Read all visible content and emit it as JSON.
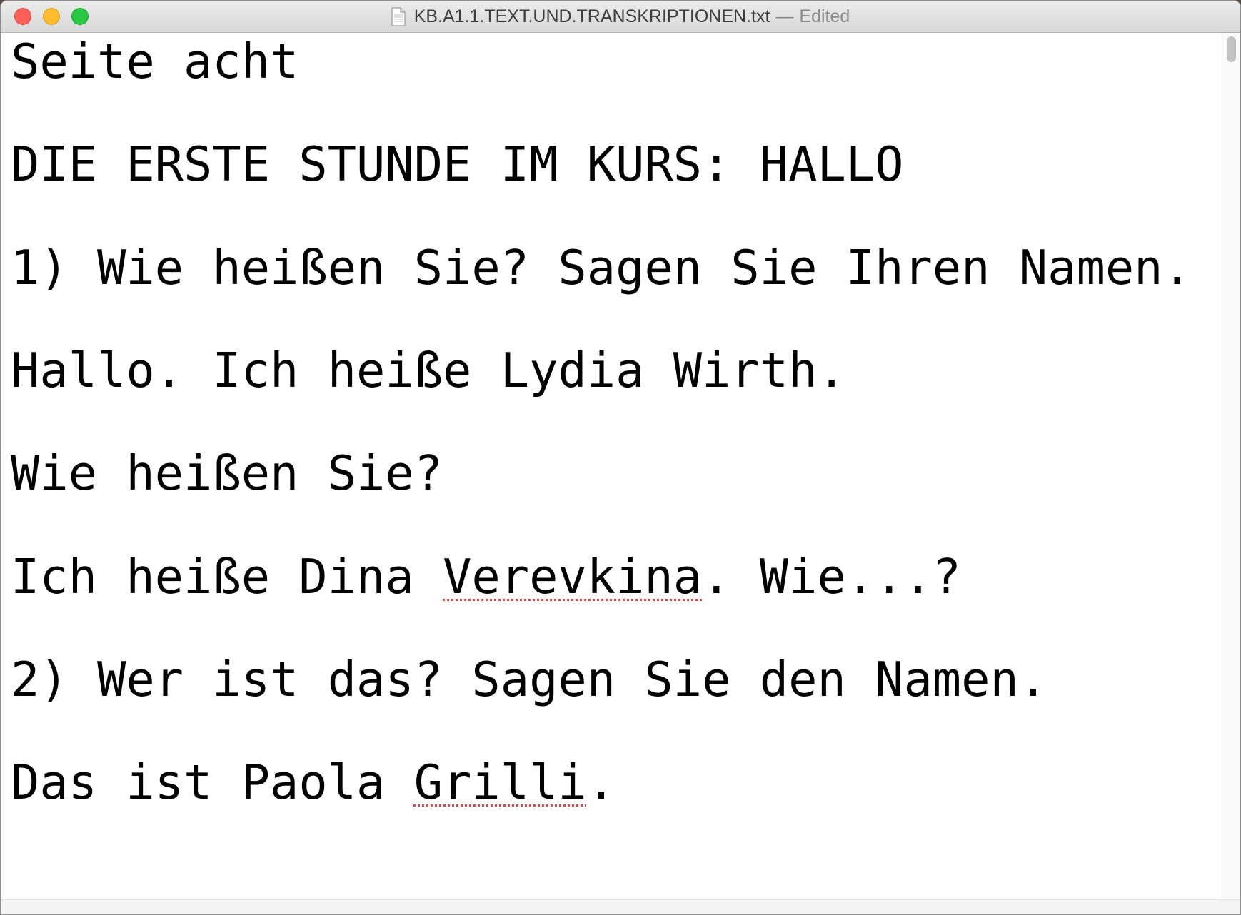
{
  "window": {
    "title": "KB.A1.1.TEXT.UND.TRANSKRIPTIONEN.txt",
    "separator": "—",
    "status": "Edited",
    "controls": {
      "close_color": "#fc5f57",
      "minimize_color": "#fdbc2e",
      "zoom_color": "#28c841"
    },
    "file_icon": "text-document-icon"
  },
  "document": {
    "lines": [
      {
        "text": "Seite acht"
      },
      {
        "text": "DIE ERSTE STUNDE IM KURS: HALLO"
      },
      {
        "text": "1) Wie heißen Sie? Sagen Sie Ihren Namen."
      },
      {
        "text": "Hallo. Ich heiße Lydia Wirth."
      },
      {
        "text": "Wie heißen Sie?"
      },
      {
        "before": "Ich heiße Dina ",
        "misspelled": "Verevkina",
        "after": ". Wie...?"
      },
      {
        "text": "2) Wer ist das? Sagen Sie den Namen."
      },
      {
        "before": "Das ist Paola ",
        "misspelled": "Grilli",
        "after": "."
      }
    ]
  },
  "colors": {
    "spellcheck_underline": "#e64545"
  }
}
